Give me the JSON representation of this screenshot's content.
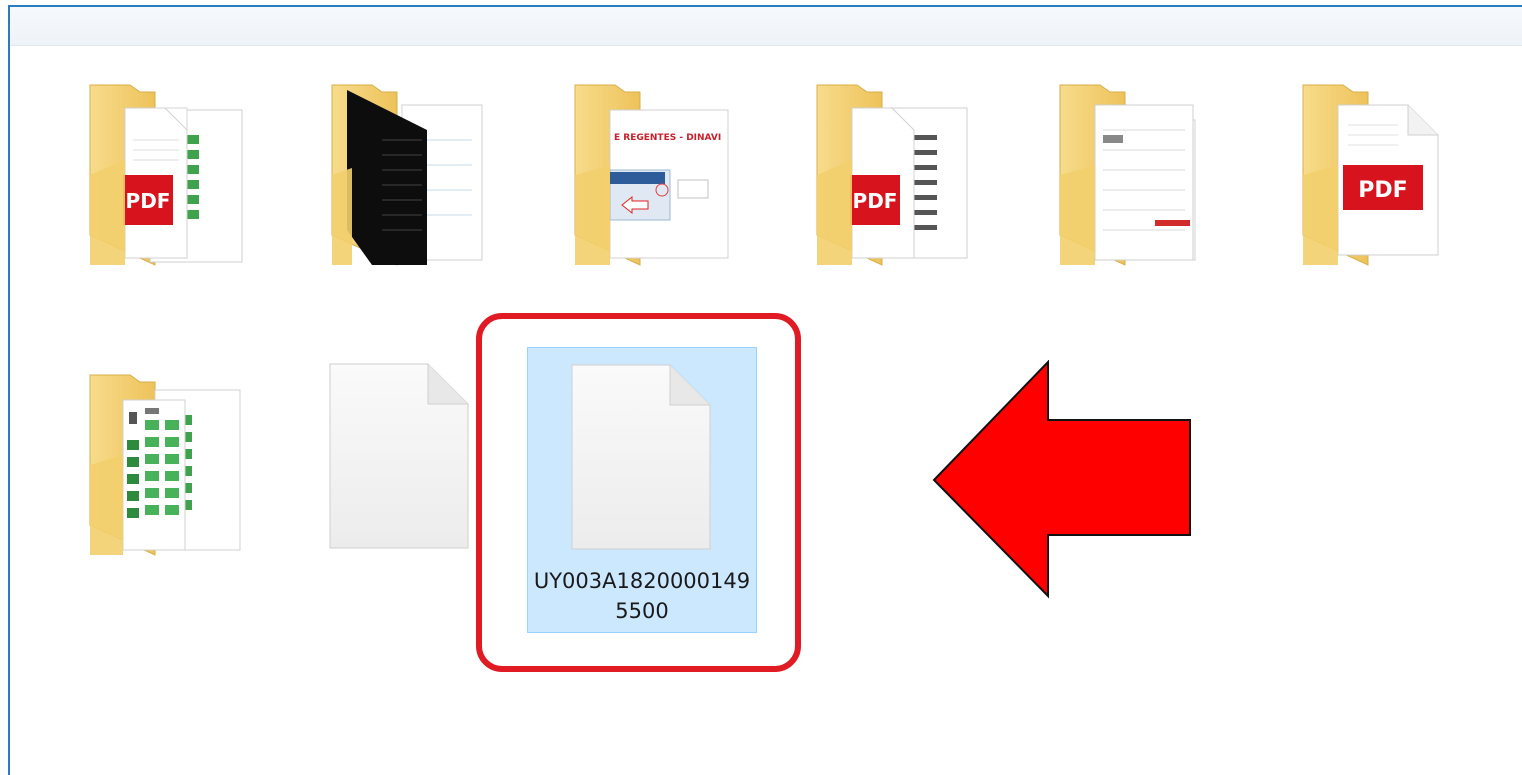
{
  "explorer": {
    "items": [
      {
        "type": "folder",
        "preview": "pdf-and-spreadsheet"
      },
      {
        "type": "folder",
        "preview": "dark-document"
      },
      {
        "type": "folder",
        "preview": "presentation",
        "preview_text": "E REGENTES - DINAVI"
      },
      {
        "type": "folder",
        "preview": "pdf-and-document"
      },
      {
        "type": "folder",
        "preview": "forms"
      },
      {
        "type": "folder",
        "preview": "pdf"
      },
      {
        "type": "folder",
        "preview": "spreadsheet"
      },
      {
        "type": "file",
        "preview": "blank"
      },
      {
        "type": "file",
        "preview": "blank",
        "selected": true,
        "label": "UY003A18200001495500"
      }
    ],
    "pdf_badge": "PDF"
  },
  "annotations": {
    "highlight_color": "#e01b24",
    "arrow_color": "#ff0000"
  },
  "colors": {
    "folder": "#f3d27a",
    "selection": "#cce8ff",
    "window_border": "#2b7bc0"
  }
}
